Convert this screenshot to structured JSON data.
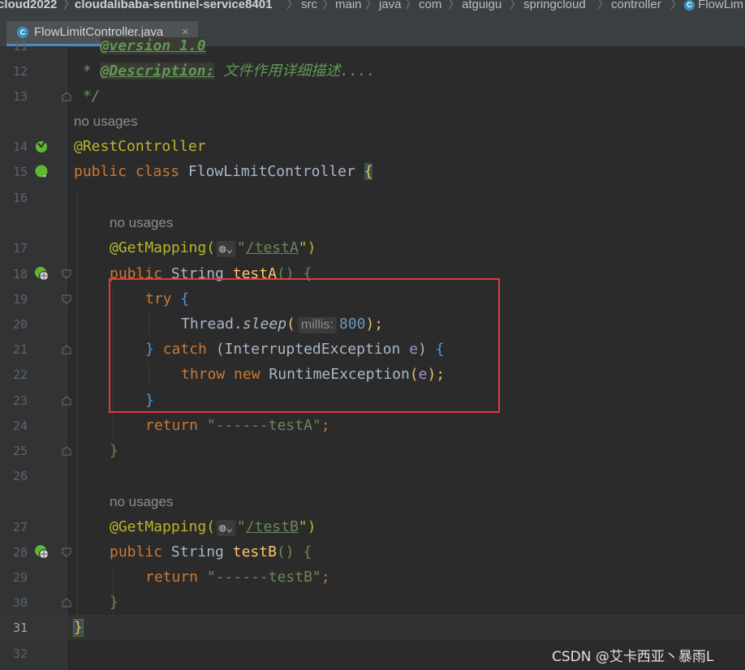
{
  "breadcrumb": {
    "items": [
      "cloud2022",
      "cloudalibaba-sentinel-service8401",
      "src",
      "main",
      "java",
      "com",
      "atguigu",
      "springcloud",
      "controller",
      "FlowLim"
    ],
    "class_icon": "C"
  },
  "tab": {
    "icon": "C",
    "label": "FlowLimitController.java",
    "close": "×"
  },
  "gutter": {
    "lines": [
      "11",
      "12",
      "13",
      "14",
      "15",
      "16",
      "17",
      "18",
      "19",
      "20",
      "21",
      "22",
      "23",
      "24",
      "25",
      "26",
      "27",
      "28",
      "29",
      "30",
      "31",
      "32"
    ],
    "current_line": "31"
  },
  "code": {
    "l11": "@version 1.0",
    "l12_star": " *",
    "l12_tag": "@Description:",
    "l12_text": "文件作用详细描述....",
    "l13": " */",
    "usage_hint": "no usages",
    "l14": "@RestController",
    "l15_kw": "public class",
    "l15_name": "FlowLimitController",
    "l15_brace": "{",
    "l17_ann": "@GetMapping(",
    "l17_globe": "⌄",
    "l17_q1": "\"",
    "l17_url": "/testA",
    "l17_q2": "\")",
    "l18_kw": "public",
    "l18_type": "String",
    "l18_name": "testA",
    "l18_rest": "() {",
    "l19_kw": "try",
    "l19_brace": "{",
    "l20_a": "Thread.",
    "l20_m": "sleep",
    "l20_p": "(",
    "l20_inlay": "millis:",
    "l20_num": "800",
    "l20_end": ");",
    "l21_close": "}",
    "l21_kw": "catch",
    "l21_rest": "(InterruptedException",
    "l21_e": "e",
    "l21_end": ")",
    "l21_brace": "{",
    "l22_kw": "throw new",
    "l22_cls": "RuntimeException",
    "l22_p1": "(",
    "l22_e": "e",
    "l22_p2": ");",
    "l23": "}",
    "l24_kw": "return",
    "l24_str": "\"------testA\"",
    "l24_end": ";",
    "l25": "}",
    "l27_ann": "@GetMapping(",
    "l27_url": "/testB",
    "l28_name": "testB",
    "l29_str": "\"------testB\"",
    "l30": "}",
    "l31": "}"
  },
  "watermark": "CSDN @艾卡西亚丶暴雨L",
  "colors": {
    "background": "#2b2b2b",
    "keyword": "#cc7832",
    "annotation": "#bbb529",
    "string": "#6a8759",
    "number": "#6897bb",
    "highlight_box": "#e03a3a"
  },
  "icons": {
    "bean": "spring-bean-icon",
    "endpoint": "web-endpoint-icon"
  }
}
